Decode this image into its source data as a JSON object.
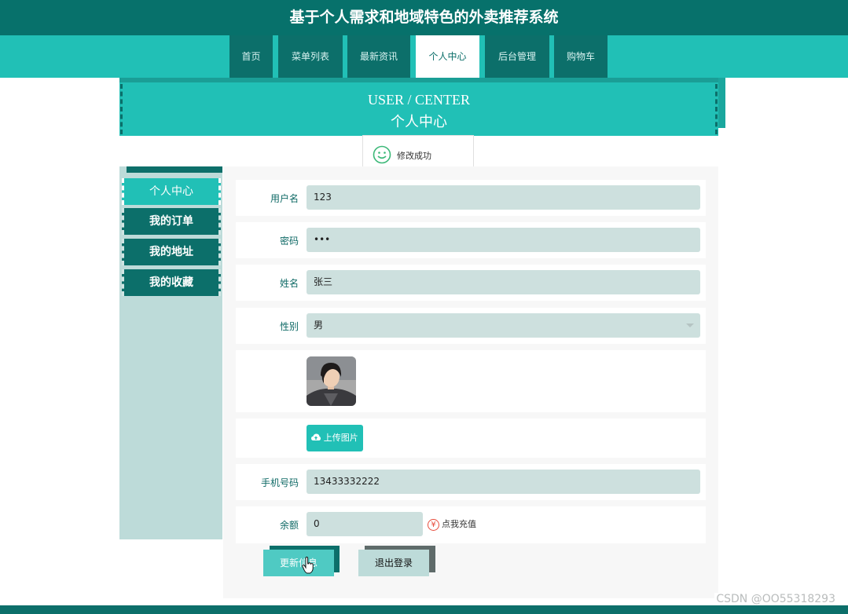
{
  "header": {
    "title": "基于个人需求和地域特色的外卖推荐系统"
  },
  "nav": {
    "items": [
      {
        "label": "首页"
      },
      {
        "label": "菜单列表"
      },
      {
        "label": "最新资讯"
      },
      {
        "label": "个人中心"
      },
      {
        "label": "后台管理"
      },
      {
        "label": "购物车"
      }
    ],
    "active": "个人中心"
  },
  "banner": {
    "en": "USER / CENTER",
    "cn": "个人中心"
  },
  "toast": {
    "icon": "smile-icon",
    "text": "修改成功"
  },
  "sidebar": {
    "items": [
      {
        "label": "个人中心"
      },
      {
        "label": "我的订单"
      },
      {
        "label": "我的地址"
      },
      {
        "label": "我的收藏"
      }
    ],
    "active": "个人中心"
  },
  "form": {
    "username": {
      "label": "用户名",
      "value": "123"
    },
    "password": {
      "label": "密码",
      "value": "•••"
    },
    "name": {
      "label": "姓名",
      "value": "张三"
    },
    "gender": {
      "label": "性别",
      "value": "男"
    },
    "upload": {
      "label": "上传图片",
      "icon": "cloud-upload-icon"
    },
    "phone": {
      "label": "手机号码",
      "value": "13433332222"
    },
    "balance": {
      "label": "余额",
      "value": "0",
      "recharge_label": "点我充值",
      "recharge_icon": "yen-icon"
    }
  },
  "buttons": {
    "update": "更新信息",
    "logout": "退出登录"
  },
  "watermark": "CSDN @OO55318293",
  "colors": {
    "primary_dark": "#0c6f6a",
    "primary": "#21c0b6",
    "field_bg": "#cde0de",
    "sidebar_bg": "#bddbd9"
  }
}
